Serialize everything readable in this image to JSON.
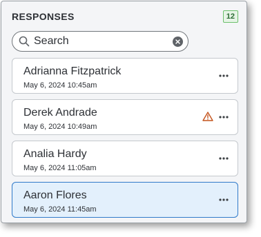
{
  "header": {
    "title": "RESPONSES",
    "count": "12"
  },
  "search": {
    "placeholder": "Search",
    "value": ""
  },
  "responses": [
    {
      "name": "Adrianna Fitzpatrick",
      "date": "May 6, 2024 10:45am",
      "warning": false,
      "selected": false
    },
    {
      "name": "Derek Andrade",
      "date": "May 6, 2024 10:49am",
      "warning": true,
      "selected": false
    },
    {
      "name": "Analia Hardy",
      "date": "May 6, 2024 11:05am",
      "warning": false,
      "selected": false
    },
    {
      "name": "Aaron Flores",
      "date": "May 6, 2024 11:45am",
      "warning": false,
      "selected": true
    }
  ],
  "icons": {
    "search": "search-icon",
    "clear": "clear-icon",
    "more": "more-options-icon",
    "warning": "warning-icon"
  },
  "colors": {
    "selected_background": "#e3f0fc",
    "selected_border": "#2f79c9",
    "warning": "#c4531c",
    "count_badge": "#2a6b32"
  }
}
